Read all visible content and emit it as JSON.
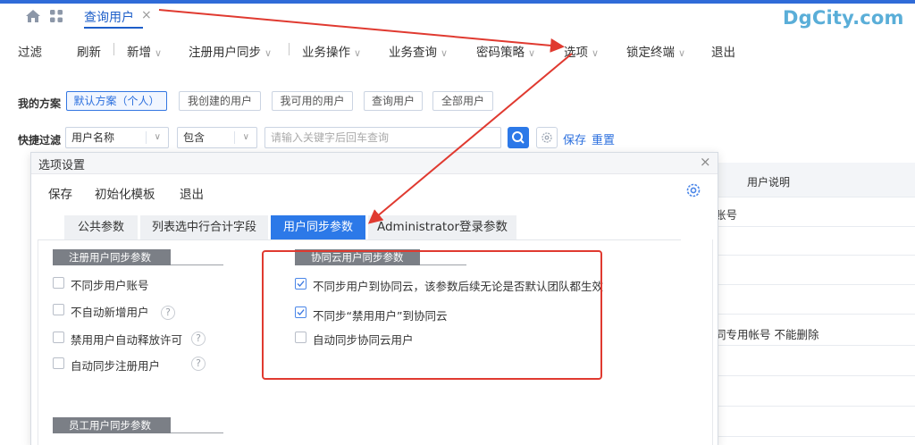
{
  "tabbar": {
    "active_tab": "查询用户",
    "close_glyph": "×",
    "brand": "DgCity.com"
  },
  "toolbar": {
    "items": [
      "过滤",
      "刷新",
      "新增",
      "注册用户同步",
      "业务操作",
      "业务查询",
      "密码策略",
      "选项",
      "锁定终端",
      "退出"
    ]
  },
  "scheme": {
    "label": "我的方案",
    "buttons": [
      "默认方案（个人）",
      "我创建的用户",
      "我可用的用户",
      "查询用户",
      "全部用户"
    ]
  },
  "quick_filter": {
    "label": "快捷过滤",
    "field": "用户名称",
    "operator": "包含",
    "placeholder": "请输入关键字后回车查询",
    "save": "保存",
    "reset": "重置"
  },
  "table": {
    "column": "用户说明",
    "cells": [
      "账号",
      "同专用帐号 不能删除"
    ]
  },
  "modal": {
    "title": "选项设置",
    "close_glyph": "×",
    "menu": [
      "保存",
      "初始化模板",
      "退出"
    ],
    "tabs": [
      "公共参数",
      "列表选中行合计字段",
      "用户同步参数",
      "Administrator登录参数"
    ],
    "active_tab": 2,
    "sections": {
      "register": {
        "title": "注册用户同步参数",
        "options": [
          {
            "label": "不同步用户账号",
            "checked": false,
            "help": false
          },
          {
            "label": "不自动新增用户",
            "checked": false,
            "help": true
          },
          {
            "label": "禁用用户自动释放许可",
            "checked": false,
            "help": true
          },
          {
            "label": "自动同步注册用户",
            "checked": false,
            "help": true
          }
        ]
      },
      "cloud": {
        "title": "协同云用户同步参数",
        "options": [
          {
            "label": "不同步用户到协同云，该参数后续无论是否默认团队都生效",
            "checked": true
          },
          {
            "label": "不同步“禁用用户”到协同云",
            "checked": true
          },
          {
            "label": "自动同步协同云用户",
            "checked": false
          }
        ]
      },
      "employee": {
        "title": "员工用户同步参数"
      }
    },
    "help_glyph": "?"
  },
  "annotation_color": "#e03a30",
  "accent_color": "#2c79e8"
}
